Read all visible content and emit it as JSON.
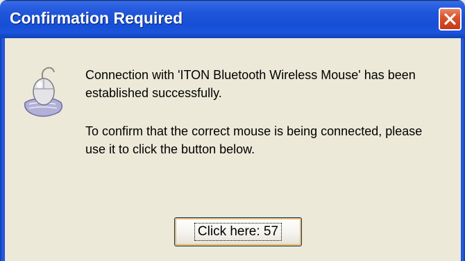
{
  "window": {
    "title": "Confirmation Required",
    "close_icon": "close-icon"
  },
  "content": {
    "icon": "bluetooth-mouse-icon",
    "message_line1": "Connection with 'ITON Bluetooth Wireless Mouse' has been\nestablished successfully.",
    "message_line2": "To confirm that the correct mouse is being connected, please\nuse it to click the button below."
  },
  "button": {
    "label": "Click here: 57"
  },
  "colors": {
    "titlebar": "#1f55d9",
    "dialog_bg": "#ece9d8",
    "close_button": "#d9532f"
  }
}
